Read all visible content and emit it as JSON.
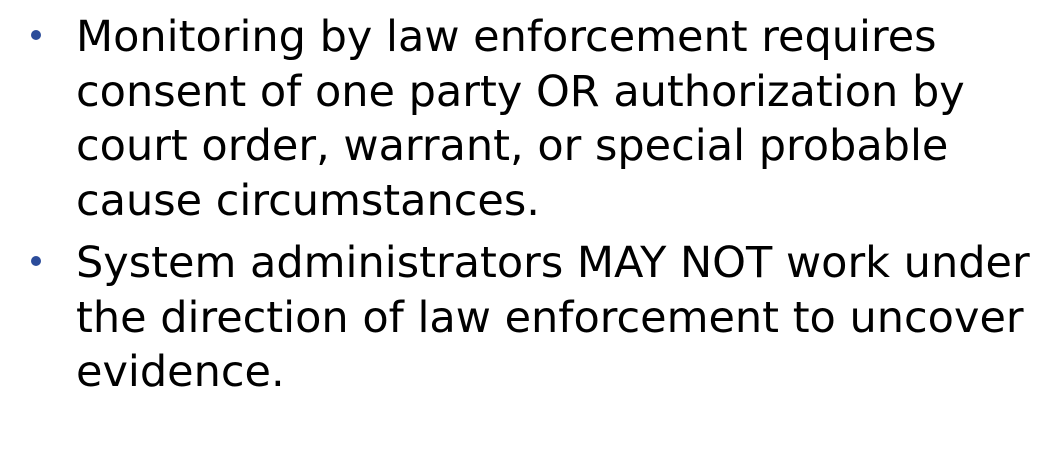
{
  "slide": {
    "bullet_color": "#2b4c9a",
    "text_color": "#000000",
    "bullets": [
      {
        "text": "Monitoring by law enforcement requires consent of one party OR authorization by court order, warrant, or special probable cause circumstances."
      },
      {
        "text": "System administrators MAY NOT work under the direction of law enforcement to uncover evidence."
      }
    ]
  }
}
